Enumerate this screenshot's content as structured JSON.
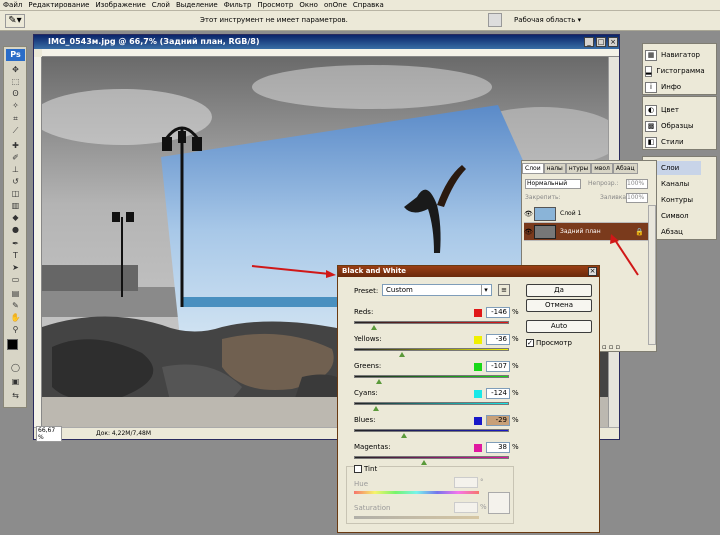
{
  "menu": [
    "Файл",
    "Редактирование",
    "Изображение",
    "Слой",
    "Выделение",
    "Фильтр",
    "Просмотр",
    "Окно",
    "onOne",
    "Справка"
  ],
  "options_bar": {
    "message": "Этот инструмент не имеет параметров.",
    "workspace_label": "Рабочая область"
  },
  "logo": "Ps",
  "document": {
    "title": "IMG_0543м.jpg @ 66,7% (Задний план, RGB/8)",
    "zoom": "66,67 %",
    "doc_size": "Док: 4,22M/7,48M"
  },
  "panels_top": [
    "Навигатор",
    "Гистограмма",
    "Инфо"
  ],
  "panels_mid": [
    "Цвет",
    "Образцы",
    "Стили"
  ],
  "panels_bottom": [
    "Слои",
    "Каналы",
    "Контуры",
    "Символ",
    "Абзац"
  ],
  "layers_panel": {
    "tabs": [
      "Слои",
      "налы",
      "нтуры",
      "мвол",
      "Абзац"
    ],
    "blend_mode": "Нормальный",
    "opacity_label": "Непрозр.:",
    "opacity": "100%",
    "lock_label": "Закрепить:",
    "fill_label": "Заливка:",
    "fill": "100%",
    "layers": [
      {
        "name": "Слой 1",
        "selected": false
      },
      {
        "name": "Задний план",
        "selected": true
      }
    ]
  },
  "bw_dialog": {
    "title": "Black and White",
    "preset_label": "Preset:",
    "preset_value": "Custom",
    "channels": [
      {
        "label": "Reds:",
        "value": "-146",
        "color": "#e01818",
        "level": 0.13
      },
      {
        "label": "Yellows:",
        "value": "-36",
        "color": "#f0f000",
        "level": 0.31
      },
      {
        "label": "Greens:",
        "value": "-107",
        "color": "#18d818",
        "level": 0.16
      },
      {
        "label": "Cyans:",
        "value": "-124",
        "color": "#18e8e8",
        "level": 0.14
      },
      {
        "label": "Blues:",
        "value": "-29",
        "color": "#1818c8",
        "level": 0.32
      },
      {
        "label": "Magentas:",
        "value": "38",
        "color": "#e018a0",
        "level": 0.45
      }
    ],
    "percent": "%",
    "ok": "Да",
    "cancel": "Отмена",
    "auto": "Auto",
    "preview_label": "Просмотр",
    "tint_label": "Tint",
    "hue_label": "Hue",
    "saturation_label": "Saturation",
    "degree": "°",
    "sat_pct": "%"
  }
}
